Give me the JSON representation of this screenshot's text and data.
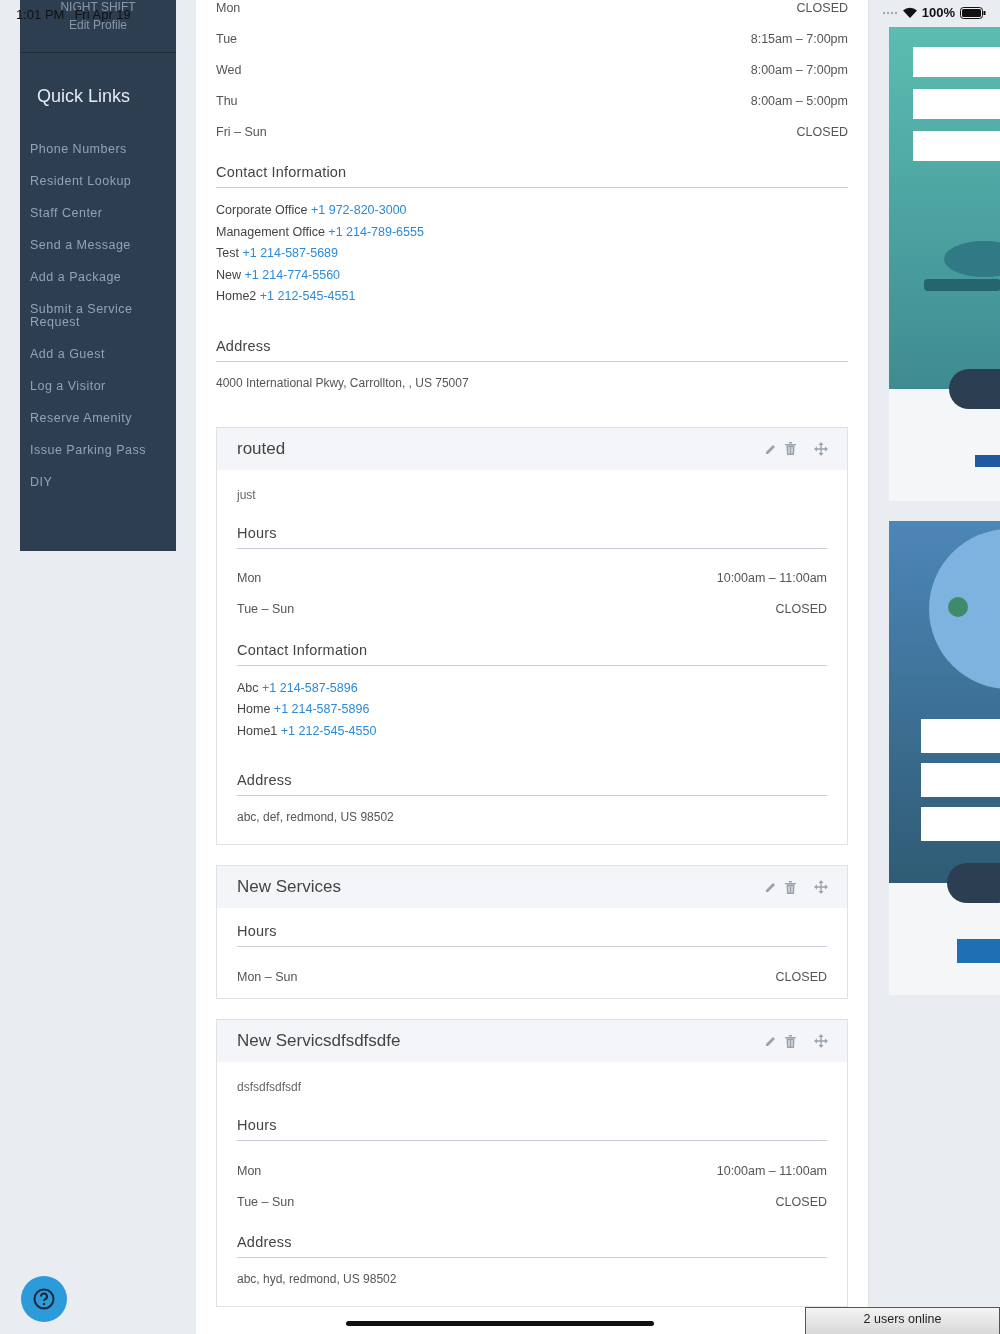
{
  "status_bar": {
    "time": "1:01 PM",
    "date": "Fri Apr 19",
    "battery": "100%"
  },
  "sidebar": {
    "profile_name": "NIGHT SHIFT",
    "edit_profile": "Edit Profile",
    "heading": "Quick Links",
    "links": [
      "Phone Numbers",
      "Resident Lookup",
      "Staff Center",
      "Send a Message",
      "Add a Package",
      "Submit a Service Request",
      "Add a Guest",
      "Log a Visitor",
      "Reserve Amenity",
      "Issue Parking Pass",
      "DIY"
    ]
  },
  "main": {
    "sections": [
      {
        "kind": "hours",
        "rows": [
          {
            "day": "Mon",
            "time": "CLOSED"
          },
          {
            "day": "Tue",
            "time": "8:15am – 7:00pm"
          },
          {
            "day": "Wed",
            "time": "8:00am – 7:00pm"
          },
          {
            "day": "Thu",
            "time": "8:00am – 5:00pm"
          },
          {
            "day": "Fri – Sun",
            "time": "CLOSED"
          }
        ]
      },
      {
        "kind": "contacts",
        "heading": "Contact Information",
        "contacts": [
          {
            "label": "Corporate Office",
            "phone": "+1 972-820-3000"
          },
          {
            "label": "Management Office",
            "phone": "+1 214-789-6555"
          },
          {
            "label": "Test",
            "phone": "+1 214-587-5689"
          },
          {
            "label": "New",
            "phone": "+1 214-774-5560"
          },
          {
            "label": "Home2",
            "phone": "+1 212-545-4551"
          }
        ]
      },
      {
        "kind": "address",
        "heading": "Address",
        "address": "4000 International Pkwy, Carrollton, , US 75007"
      }
    ]
  },
  "services": [
    {
      "title": "routed",
      "description": "just",
      "sections": [
        {
          "kind": "hours",
          "heading": "Hours",
          "rows": [
            {
              "day": "Mon",
              "time": "10:00am – 11:00am"
            },
            {
              "day": "Tue – Sun",
              "time": "CLOSED"
            }
          ]
        },
        {
          "kind": "contacts",
          "heading": "Contact Information",
          "contacts": [
            {
              "label": "Abc",
              "phone": "+1 214-587-5896"
            },
            {
              "label": "Home",
              "phone": "+1 214-587-5896"
            },
            {
              "label": "Home1",
              "phone": "+1 212-545-4550"
            }
          ]
        },
        {
          "kind": "address",
          "heading": "Address",
          "address": "abc, def, redmond, US 98502"
        }
      ]
    },
    {
      "title": "New Services",
      "sections": [
        {
          "kind": "hours",
          "heading": "Hours",
          "rows": [
            {
              "day": "Mon – Sun",
              "time": "CLOSED"
            }
          ]
        }
      ]
    },
    {
      "title": "New Servicsdfsdfsdfe",
      "description": "dsfsdfsdfsdf",
      "sections": [
        {
          "kind": "hours",
          "heading": "Hours",
          "rows": [
            {
              "day": "Mon",
              "time": "10:00am – 11:00am"
            },
            {
              "day": "Tue – Sun",
              "time": "CLOSED"
            }
          ]
        },
        {
          "kind": "address",
          "heading": "Address",
          "address": "abc, hyd, redmond, US 98502"
        }
      ]
    }
  ],
  "online_status": "2 users online"
}
